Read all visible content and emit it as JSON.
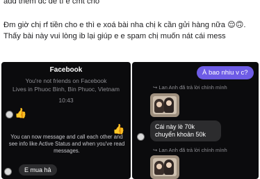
{
  "post": {
    "line1": "add thêm đc để tí e cmt cho",
    "caption": "Đm giờ chị rf tiền cho e thì e xoá bài nha chị k cần gửi hàng nữa 😌🙃. Thấy bài này vui lòng ib lại giúp e e spam chị muốn nát cái mess"
  },
  "left_chat": {
    "header_faded": "·· ·",
    "title": "Facebook",
    "not_friends": "You're not friends on Facebook",
    "lives_in": "Lives in Phuoc Binh, Bin Phuoc, Vietnam",
    "time": "10:43",
    "like_icon": "thumbs-up-icon",
    "info_text": "You can now message and call each other and see info like Active Status and when you've read messages.",
    "message": "E mua hả"
  },
  "right_chat": {
    "outgoing": "À bao nhiu v c?",
    "reply_header_1": "↪ Lan Anh đã trả lời chính mình",
    "photo_caption": "Cái này lè 70k chuyển khoản 50k",
    "reply_header_2": "↪ Lan Anh đã trả lời chính mình"
  },
  "colors": {
    "panel_bg": "#0b0b0d",
    "incoming_bubble": "#2c2c2e",
    "outgoing_bubble": "#6e5ce6",
    "like_blue": "#4a7bff"
  }
}
